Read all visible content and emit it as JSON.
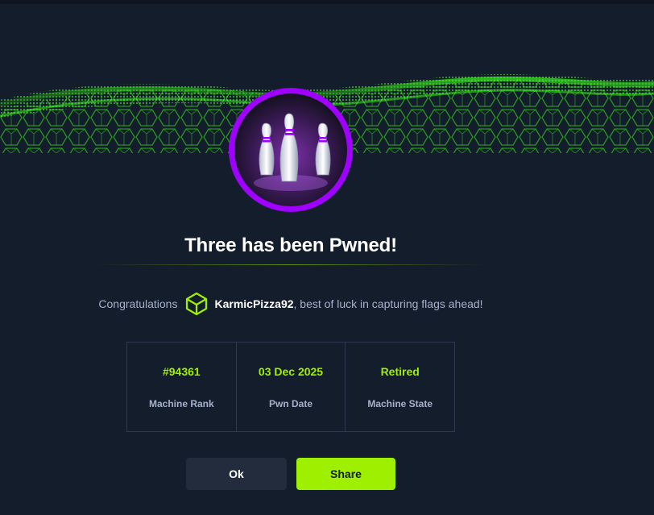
{
  "modal": {
    "title": "Three has been Pwned!",
    "congrats_prefix": "Congratulations",
    "username": "KarmicPizza92",
    "congrats_suffix": ", best of luck in capturing flags ahead!",
    "user_icon": "hexagon-cube-icon",
    "badge_icon": "bowling-pins-icon"
  },
  "stats": [
    {
      "value": "#94361",
      "label": "Machine Rank"
    },
    {
      "value": "03 Dec 2025",
      "label": "Pwn Date"
    },
    {
      "value": "Retired",
      "label": "Machine State"
    }
  ],
  "buttons": {
    "ok_label": "Ok",
    "share_label": "Share"
  },
  "colors": {
    "background": "#141d2b",
    "accent": "#9fef00",
    "badge_ring": "#9f00ff",
    "muted_text": "#a4b1cd"
  }
}
